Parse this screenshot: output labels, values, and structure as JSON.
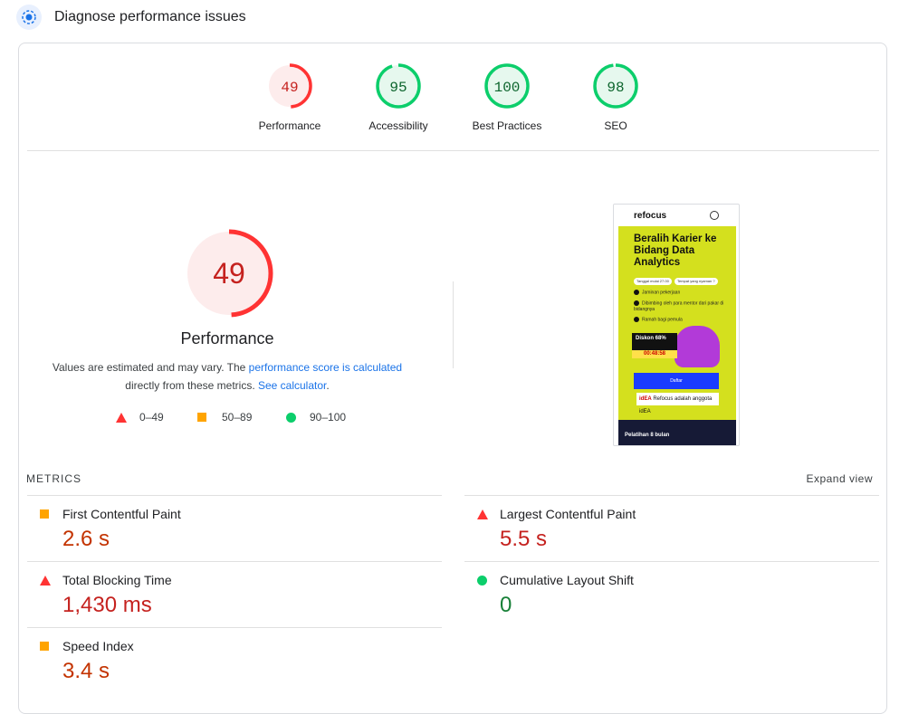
{
  "header": {
    "title": "Diagnose performance issues",
    "icon": "lighthouse-icon"
  },
  "categories": [
    {
      "score": "49",
      "value": 49,
      "label": "Performance",
      "color": "#ff3333",
      "bg": "#fdecec",
      "text_color": "#c5221f"
    },
    {
      "score": "95",
      "value": 95,
      "label": "Accessibility",
      "color": "#0cce6b",
      "bg": "#e6f8ee",
      "text_color": "#0d652d"
    },
    {
      "score": "100",
      "value": 100,
      "label": "Best Practices",
      "color": "#0cce6b",
      "bg": "#e6f8ee",
      "text_color": "#0d652d"
    },
    {
      "score": "98",
      "value": 98,
      "label": "SEO",
      "color": "#0cce6b",
      "bg": "#e6f8ee",
      "text_color": "#0d652d"
    }
  ],
  "performance": {
    "score": "49",
    "value": 49,
    "title": "Performance",
    "desc_1": "Values are estimated and may vary. The ",
    "desc_link_1": "performance score is calculated",
    "desc_2": " directly from these metrics. ",
    "desc_link_2": "See calculator",
    "desc_3": "."
  },
  "legend": [
    {
      "label": "0–49",
      "shape": "triangle",
      "color": "#ff3333"
    },
    {
      "label": "50–89",
      "shape": "square",
      "color": "#ffa400"
    },
    {
      "label": "90–100",
      "shape": "circle",
      "color": "#0cce6b"
    }
  ],
  "screenshot": {
    "brand": "refocus",
    "headline": "Beralih Karier ke Bidang Data Analytics",
    "chip_1": "Tanggal mulai 27.00",
    "chip_2": "Tempat yang nyaman ?",
    "check_1": "Jaminan pekerjaan",
    "check_2": "Dibimbing oleh para mentor dari pakar di bidangnya",
    "check_3": "Ramah bagi pemula",
    "promo": "Diskon 68%",
    "timer": "00:48:58",
    "cta": "Daftar",
    "partner_logo": "idEA",
    "partner_text": "Refocus adalah anggota idEA",
    "footer": "Pelatihan 8 bulan"
  },
  "metrics": {
    "label": "METRICS",
    "expand": "Expand view",
    "items": [
      {
        "name": "First Contentful Paint",
        "value": "2.6 s",
        "status": "average"
      },
      {
        "name": "Largest Contentful Paint",
        "value": "5.5 s",
        "status": "fail"
      },
      {
        "name": "Total Blocking Time",
        "value": "1,430 ms",
        "status": "fail"
      },
      {
        "name": "Cumulative Layout Shift",
        "value": "0",
        "status": "pass"
      },
      {
        "name": "Speed Index",
        "value": "3.4 s",
        "status": "average"
      }
    ]
  }
}
